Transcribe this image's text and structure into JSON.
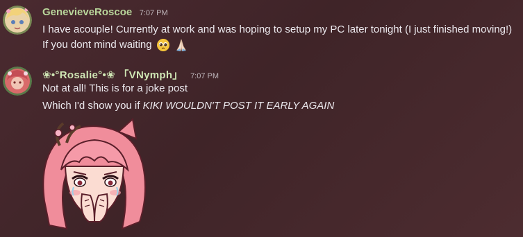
{
  "messages": [
    {
      "username": "GenevieveRoscoe",
      "timestamp": "7:07 PM",
      "avatar_icon": "avatar-anime-girl-blonde",
      "lines": [
        "I have acouple! Currently at work and was hoping to setup my PC later tonight (I just finished moving!)",
        "If you dont mind waiting"
      ],
      "emojis": [
        "pleading-face-icon",
        "folded-hands-icon"
      ]
    },
    {
      "username": "❀•°Rosalie°•❀ 「VNymph」",
      "timestamp": "7:07 PM",
      "avatar_icon": "avatar-pink-character",
      "lines": [
        "Not at all! This is for a joke post",
        "Which I'd show you if "
      ],
      "italic_text": "KIKI WOULDN'T POST IT EARLY AGAIN",
      "sticker": "pink-hair-girl-crying-emote"
    }
  ],
  "colors": {
    "background": "#452830",
    "username": "#b8d59a",
    "text": "#ece9ee",
    "timestamp": "#bfb6bb"
  }
}
